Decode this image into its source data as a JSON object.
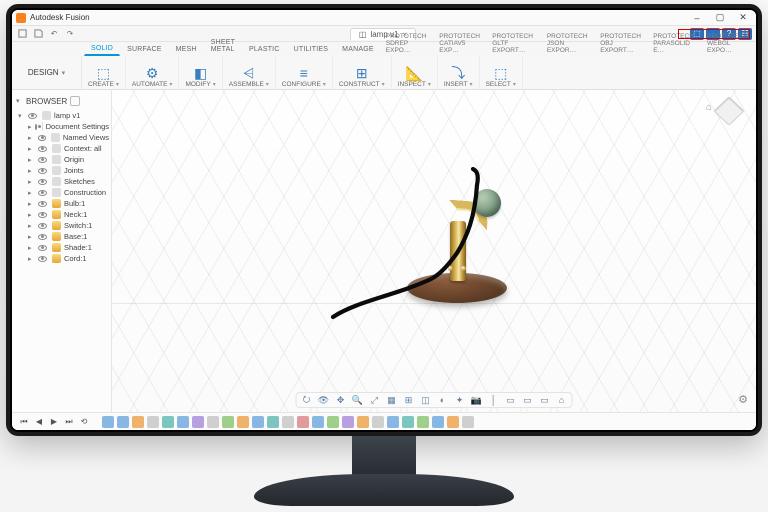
{
  "app": {
    "title": "Autodesk Fusion",
    "workspace": "DESIGN"
  },
  "window_controls": {
    "min": "–",
    "max": "▢",
    "close": "✕"
  },
  "quick_access": [
    "file",
    "save",
    "undo",
    "redo"
  ],
  "doc": {
    "name": "lamp v1",
    "close": "×"
  },
  "title_icons": [
    "ext",
    "user",
    "help",
    "notify"
  ],
  "ribbon_tabs": {
    "primary": [
      "SOLID",
      "SURFACE",
      "MESH",
      "SHEET METAL",
      "PLASTIC",
      "UTILITIES",
      "MANAGE"
    ],
    "exports": [
      "PROTOTECH SDREP EXPO…",
      "PROTOTECH CATIAV5 EXP…",
      "PROTOTECH GLTF EXPORT…",
      "PROTOTECH JSON EXPOR…",
      "PROTOTECH OBJ EXPORT…",
      "PROTOTECH PARASOLID E…",
      "PROTOTECH WEBGL EXPO…"
    ],
    "active": "SOLID"
  },
  "ribbon_groups": [
    {
      "label": "CREATE",
      "glyph": "⬚"
    },
    {
      "label": "AUTOMATE",
      "glyph": "⚙"
    },
    {
      "label": "MODIFY",
      "glyph": "◧"
    },
    {
      "label": "ASSEMBLE",
      "glyph": "⩤"
    },
    {
      "label": "CONFIGURE",
      "glyph": "≡"
    },
    {
      "label": "CONSTRUCT",
      "glyph": "⊞"
    },
    {
      "label": "INSPECT",
      "glyph": "📐"
    },
    {
      "label": "INSERT",
      "glyph": "⤵"
    },
    {
      "label": "SELECT",
      "glyph": "⬚"
    }
  ],
  "browser": {
    "header": "BROWSER",
    "root": "lamp v1",
    "nodes": [
      {
        "label": "Document Settings",
        "exp": "closed"
      },
      {
        "label": "Named Views",
        "exp": "closed"
      },
      {
        "label": "Context: all",
        "exp": "closed"
      },
      {
        "label": "Origin",
        "exp": "closed"
      },
      {
        "label": "Joints",
        "exp": "closed"
      },
      {
        "label": "Sketches",
        "exp": "closed"
      },
      {
        "label": "Construction",
        "exp": "closed"
      },
      {
        "label": "Bulb:1",
        "exp": "closed",
        "comp": true
      },
      {
        "label": "Neck:1",
        "exp": "closed",
        "comp": true
      },
      {
        "label": "Switch:1",
        "exp": "closed",
        "comp": true
      },
      {
        "label": "Base:1",
        "exp": "closed",
        "comp": true
      },
      {
        "label": "Shade:1",
        "exp": "closed",
        "comp": true
      },
      {
        "label": "Cord:1",
        "exp": "closed",
        "comp": true
      }
    ]
  },
  "navbar": [
    "orbit",
    "look",
    "pan",
    "zoom",
    "fit",
    "grid-toggle",
    "snap",
    "section",
    "render-style",
    "effects",
    "camera",
    "split1",
    "view-front",
    "view-top",
    "view-right",
    "view-home"
  ],
  "timeline": {
    "play_controls": [
      "⏮",
      "◀",
      "▶",
      "⏭",
      "⟲"
    ],
    "features": [
      "f-blue",
      "f-blue",
      "f-orange",
      "f-grey",
      "f-teal",
      "f-blue",
      "f-purple",
      "f-grey",
      "f-green",
      "f-orange",
      "f-blue",
      "f-teal",
      "f-grey",
      "f-red",
      "f-blue",
      "f-green",
      "f-purple",
      "f-orange",
      "f-grey",
      "f-blue",
      "f-teal",
      "f-green",
      "f-blue",
      "f-orange",
      "f-grey"
    ]
  }
}
